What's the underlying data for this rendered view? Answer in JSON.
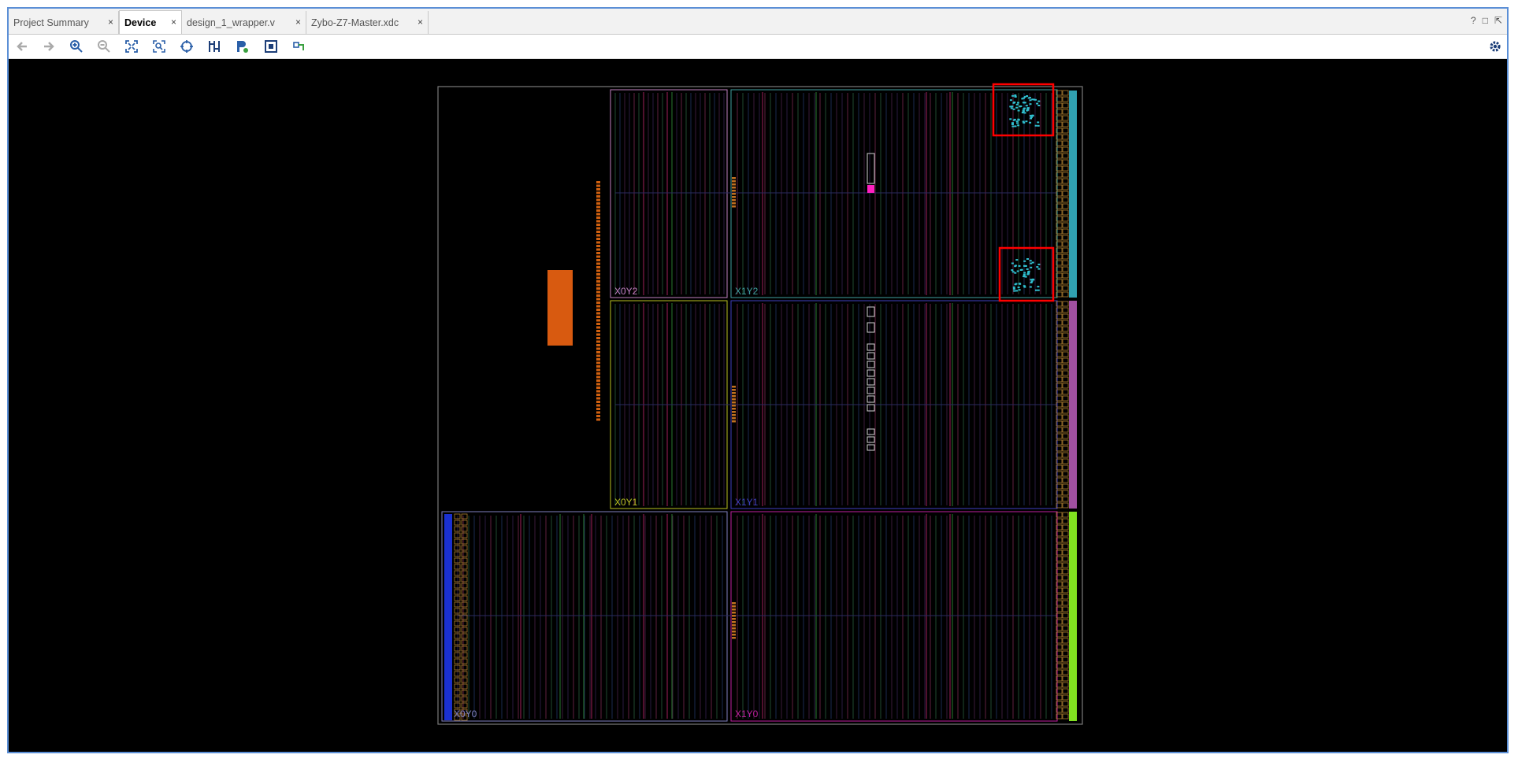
{
  "tabs": [
    {
      "label": "Project Summary",
      "active": false
    },
    {
      "label": "Device",
      "active": true
    },
    {
      "label": "design_1_wrapper.v",
      "active": false
    },
    {
      "label": "Zybo-Z7-Master.xdc",
      "active": false
    }
  ],
  "close_glyph": "×",
  "window_controls": {
    "help": "?",
    "restore": "□",
    "float": "⇱"
  },
  "toolbar_icons": [
    "back-icon",
    "forward-icon",
    "zoom-in-icon",
    "zoom-out-icon",
    "zoom-fit-icon",
    "zoom-to-selection-icon",
    "autofit-selection-icon",
    "routing-resources-icon",
    "show-placed-icon",
    "show-io-icon",
    "pblock-icon"
  ],
  "settings_icon": "gear-icon",
  "clock_regions": [
    {
      "label": "X0Y2",
      "color": "#c080c0"
    },
    {
      "label": "X1Y2",
      "color": "#40a0a0"
    },
    {
      "label": "X0Y1",
      "color": "#b8c020"
    },
    {
      "label": "X1Y1",
      "color": "#4040c0"
    },
    {
      "label": "X0Y0",
      "color": "#8080c0"
    },
    {
      "label": "X1Y0",
      "color": "#c020a0"
    }
  ],
  "colors": {
    "highlight": "#ff0000",
    "ps_block": "#d85a10",
    "accent_cyan": "#30c0d0"
  }
}
